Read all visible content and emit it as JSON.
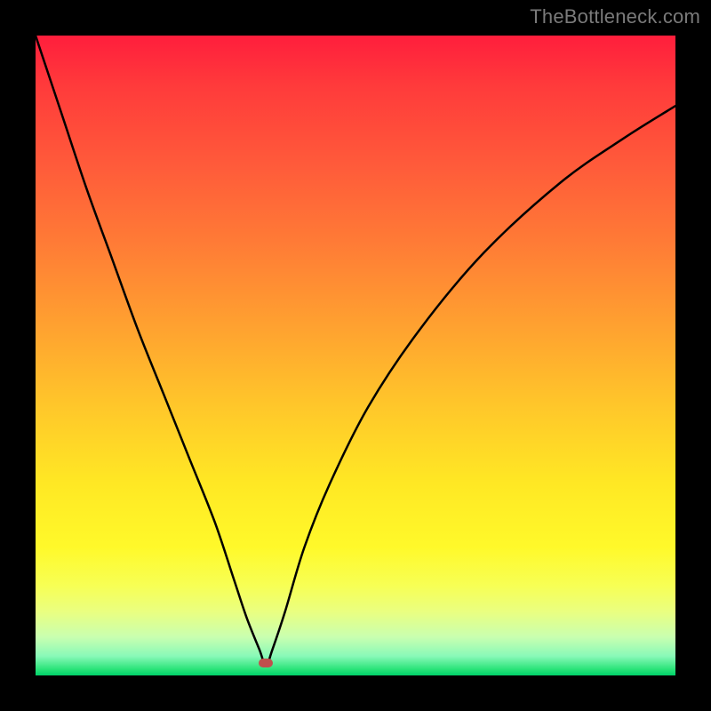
{
  "watermark": {
    "text": "TheBottleneck.com"
  },
  "colors": {
    "curve": "#000000",
    "marker": "#c0504d",
    "frame": "#000000"
  },
  "chart_data": {
    "type": "line",
    "title": "",
    "xlabel": "",
    "ylabel": "",
    "xlim": [
      0,
      100
    ],
    "ylim": [
      0,
      100
    ],
    "grid": false,
    "legend": false,
    "annotations": [
      {
        "kind": "marker",
        "x": 36,
        "y": 2,
        "shape": "rounded-rect",
        "color": "#c0504d"
      }
    ],
    "series": [
      {
        "name": "bottleneck-curve",
        "color": "#000000",
        "x": [
          0,
          4,
          8,
          12,
          16,
          20,
          24,
          28,
          31,
          33,
          35,
          36,
          37,
          39,
          42,
          46,
          52,
          60,
          70,
          82,
          92,
          100
        ],
        "y": [
          100,
          88,
          76,
          65,
          54,
          44,
          34,
          24,
          15,
          9,
          4,
          1.5,
          4,
          10,
          20,
          30,
          42,
          54,
          66,
          77,
          84,
          89
        ]
      }
    ],
    "background_gradient": [
      {
        "stop": 0,
        "color": "#ff1e3c"
      },
      {
        "stop": 8,
        "color": "#ff3b3b"
      },
      {
        "stop": 20,
        "color": "#ff5a3a"
      },
      {
        "stop": 32,
        "color": "#ff7a36"
      },
      {
        "stop": 45,
        "color": "#ffa030"
      },
      {
        "stop": 58,
        "color": "#ffc72a"
      },
      {
        "stop": 70,
        "color": "#ffe824"
      },
      {
        "stop": 80,
        "color": "#fff92a"
      },
      {
        "stop": 86,
        "color": "#f7ff55"
      },
      {
        "stop": 90,
        "color": "#eaff80"
      },
      {
        "stop": 94,
        "color": "#c9ffb0"
      },
      {
        "stop": 97,
        "color": "#88f9b8"
      },
      {
        "stop": 99,
        "color": "#2be47a"
      },
      {
        "stop": 100,
        "color": "#00d26a"
      }
    ]
  }
}
